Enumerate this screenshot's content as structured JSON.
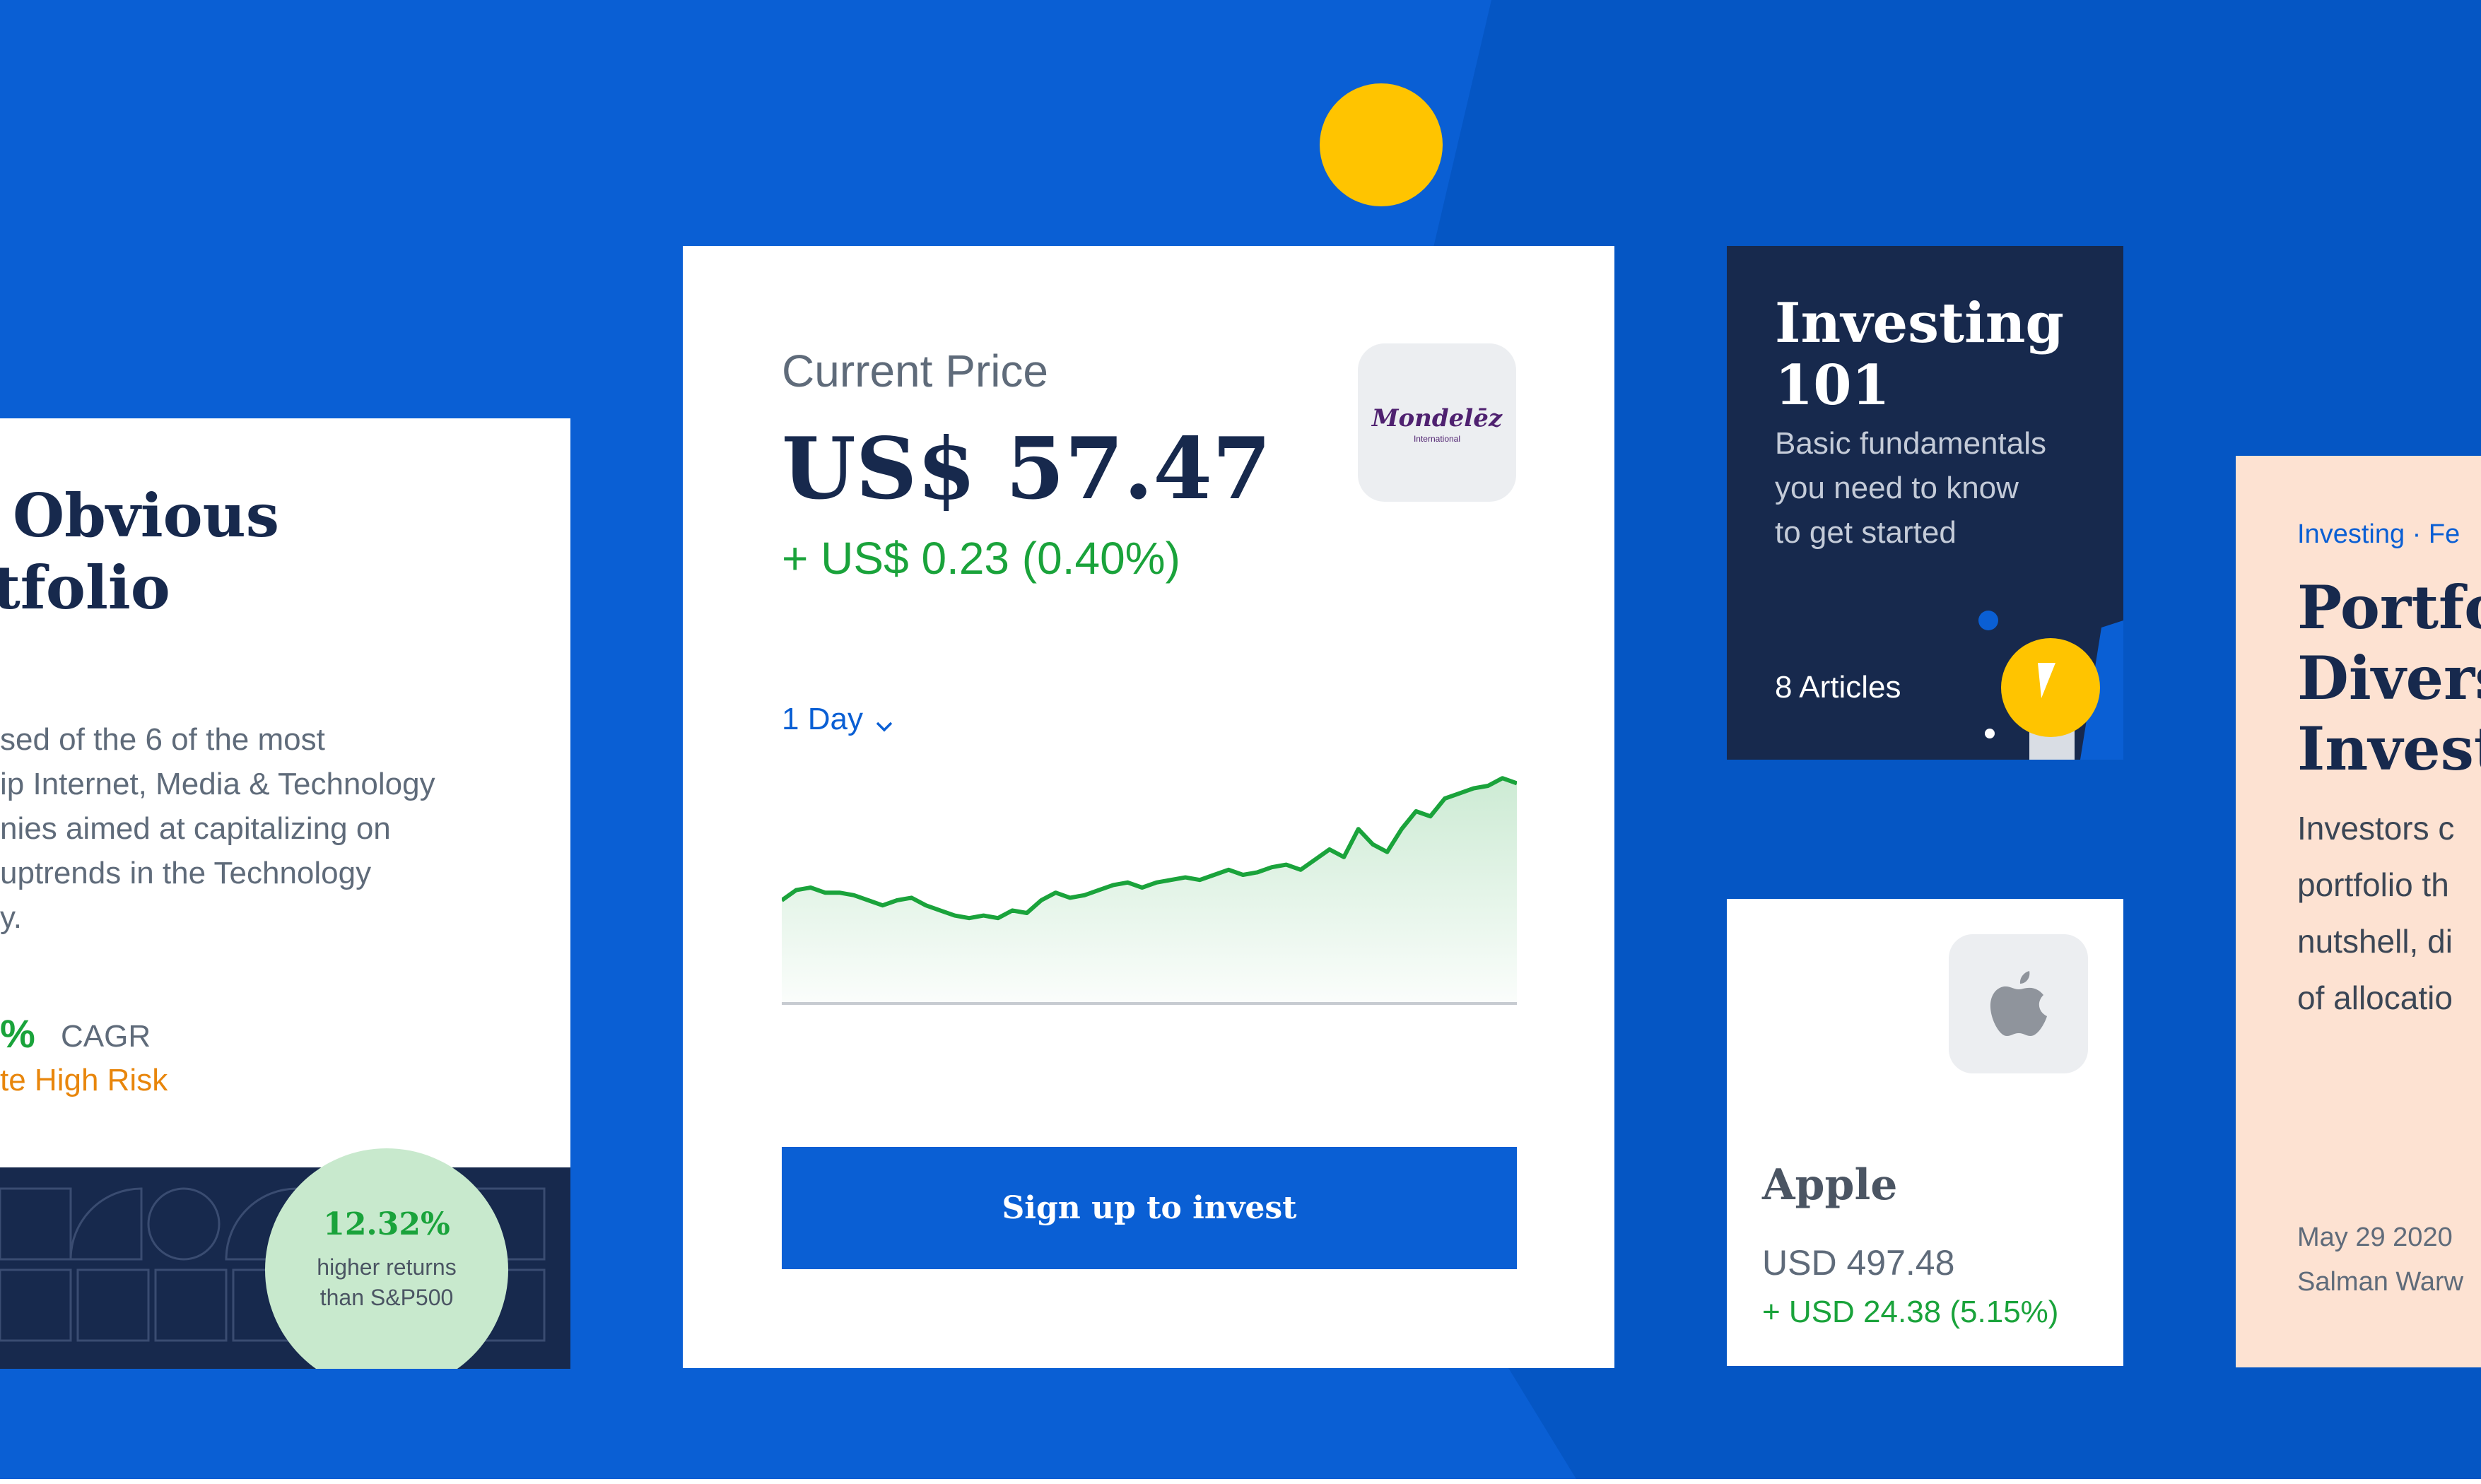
{
  "colors": {
    "background_blue": "#0a5fd4",
    "navy": "#17294d",
    "positive_green": "#1aa33b",
    "risk_orange": "#e8860c",
    "yellow_accent": "#ffc400",
    "peach": "#fde2d2"
  },
  "portfolio_card": {
    "title_line1": "Obvious",
    "title_line2": "tfolio",
    "description_lines": [
      "sed of the 6 of the most",
      "ip Internet, Media & Technology",
      "nies aimed at capitalizing on",
      "uptrends in the Technology",
      "y."
    ],
    "cagr_value": "%",
    "cagr_label": "CAGR",
    "risk_label": "te High Risk",
    "badge_value": "12.32%",
    "badge_line1": "higher returns",
    "badge_line2": "than S&P500"
  },
  "price_card": {
    "label": "Current Price",
    "price": "US$ 57.47",
    "change": "+ US$ 0.23 (0.40%)",
    "logo_text": "Mondelēz",
    "logo_subtext": "International",
    "timeframe": "1 Day",
    "signup_button": "Sign up to invest"
  },
  "chart_data": {
    "type": "area",
    "title": "",
    "xlabel": "",
    "ylabel": "",
    "ylim": [
      0,
      100
    ],
    "series": [
      {
        "values": [
          40,
          44,
          45,
          43,
          43,
          42,
          40,
          38,
          40,
          41,
          38,
          36,
          34,
          33,
          34,
          33,
          36,
          35,
          40,
          43,
          41,
          42,
          44,
          46,
          47,
          45,
          47,
          48,
          49,
          48,
          50,
          52,
          50,
          51,
          53,
          54,
          52,
          56,
          60,
          57,
          68,
          62,
          59,
          68,
          75,
          73,
          80,
          82,
          84,
          85,
          88,
          86
        ]
      }
    ]
  },
  "investing_card": {
    "title_line1": "Investing",
    "title_line2": "101",
    "desc_lines": [
      "Basic fundamentals",
      "you need to know",
      "to get started"
    ],
    "articles": "8 Articles"
  },
  "apple_card": {
    "name": "Apple",
    "price": "USD 497.48",
    "change": "+ USD 24.38 (5.15%)",
    "logo_icon": "apple-logo-icon"
  },
  "article_card": {
    "category": "Investing · Fe",
    "title_lines": [
      "Portfo",
      "Divers",
      "Invest"
    ],
    "body_lines": [
      "Investors c",
      "portfolio th",
      "nutshell, di",
      "of allocatio"
    ],
    "date": "May 29 2020",
    "author": "Salman Warw"
  }
}
